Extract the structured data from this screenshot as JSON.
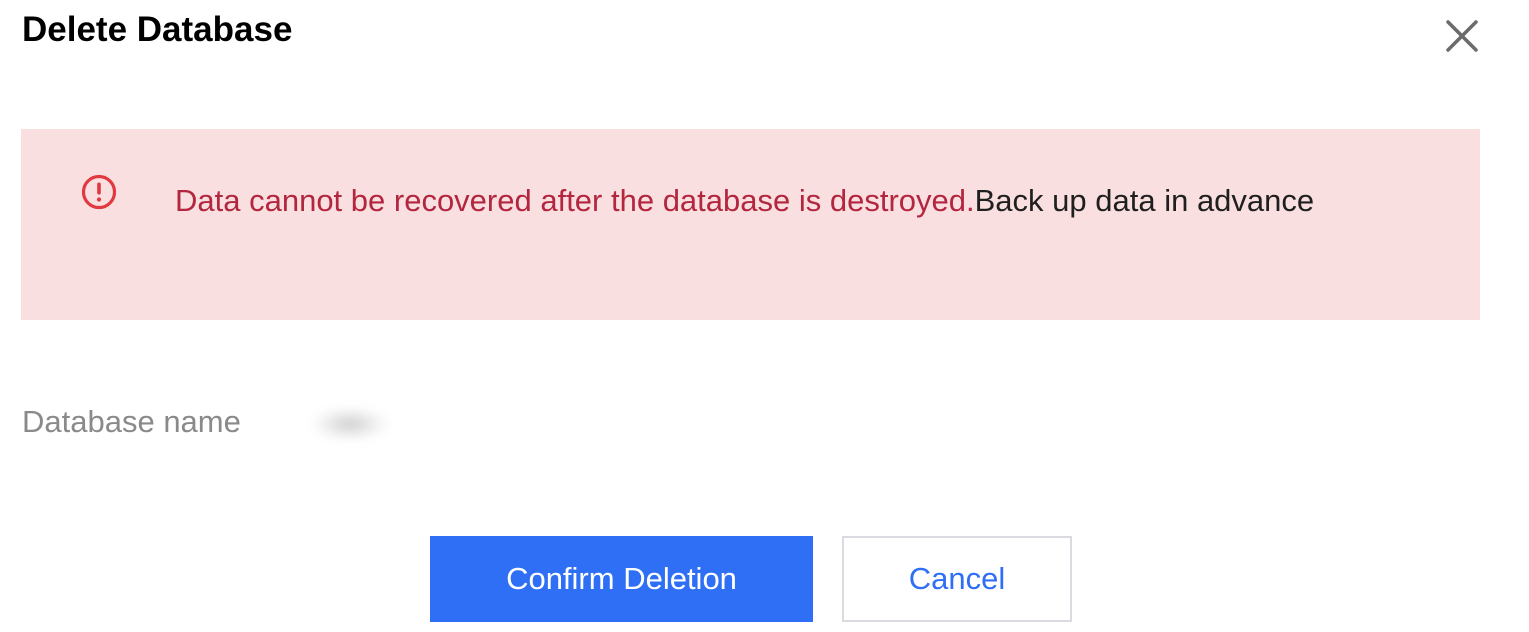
{
  "dialog": {
    "title": "Delete Database",
    "close_icon": "close-icon"
  },
  "alert": {
    "icon": "exclamation-circle-icon",
    "warning_text": "Data cannot be recovered after the database is destroyed.",
    "advice_text": "Back up data in advance",
    "warning_color": "#b3263f",
    "background_color": "#f9dfe0"
  },
  "field": {
    "label": "Database name",
    "value": ""
  },
  "buttons": {
    "confirm_label": "Confirm Deletion",
    "cancel_label": "Cancel",
    "primary_color": "#2f6ff6"
  }
}
